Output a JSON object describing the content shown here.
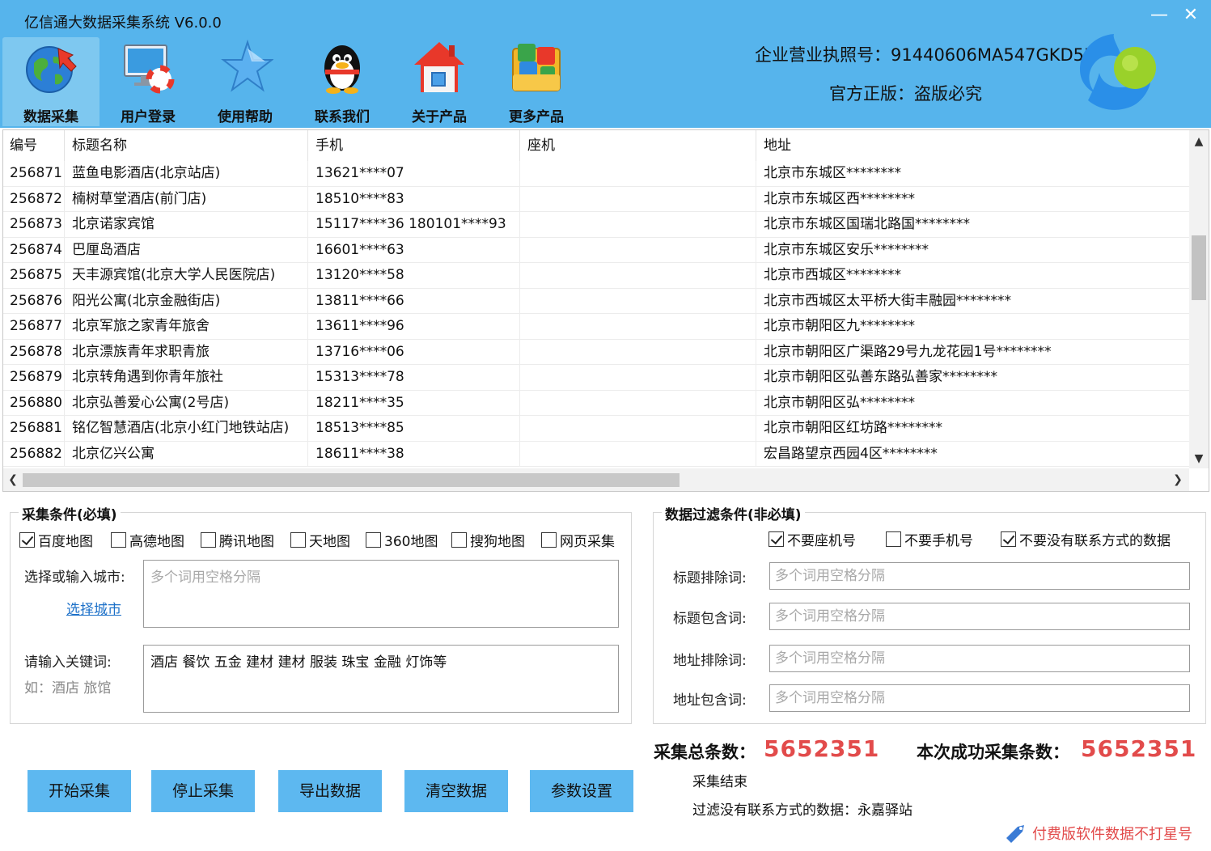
{
  "app": {
    "title": "亿信通大数据采集系统 V6.0.0",
    "minimize": "—",
    "close": "✕"
  },
  "toolbar": [
    {
      "label": "数据采集",
      "icon": "globe-icon"
    },
    {
      "label": "用户登录",
      "icon": "monitor-lifebuoy-icon"
    },
    {
      "label": "使用帮助",
      "icon": "star-icon"
    },
    {
      "label": "联系我们",
      "icon": "penguin-icon"
    },
    {
      "label": "关于产品",
      "icon": "house-icon"
    },
    {
      "label": "更多产品",
      "icon": "folder-apps-icon"
    }
  ],
  "header": {
    "license": "企业营业执照号：91440606MA547GKD5K",
    "genuine": "官方正版：盗版必究"
  },
  "table": {
    "columns": [
      "编号",
      "标题名称",
      "手机",
      "座机",
      "地址"
    ],
    "rows": [
      [
        "256871",
        "蓝鱼电影酒店(北京站店)",
        "13621****07",
        "",
        "北京市东城区********"
      ],
      [
        "256872",
        "楠树草堂酒店(前门店)",
        "18510****83",
        "",
        "北京市东城区西********"
      ],
      [
        "256873",
        "北京诺家宾馆",
        "15117****36 180101****93",
        "",
        "北京市东城区国瑞北路国********"
      ],
      [
        "256874",
        "巴厘岛酒店",
        "16601****63",
        "",
        "北京市东城区安乐********"
      ],
      [
        "256875",
        "天丰源宾馆(北京大学人民医院店)",
        "13120****58",
        "",
        "北京市西城区********"
      ],
      [
        "256876",
        "阳光公寓(北京金融街店)",
        "13811****66",
        "",
        "北京市西城区太平桥大街丰融园********"
      ],
      [
        "256877",
        "北京军旅之家青年旅舍",
        "13611****96",
        "",
        "北京市朝阳区九********"
      ],
      [
        "256878",
        "北京漂族青年求职青旅",
        "13716****06",
        "",
        "北京市朝阳区广渠路29号九龙花园1号********"
      ],
      [
        "256879",
        "北京转角遇到你青年旅社",
        "15313****78",
        "",
        "北京市朝阳区弘善东路弘善家********"
      ],
      [
        "256880",
        "北京弘善爱心公寓(2号店)",
        "18211****35",
        "",
        "北京市朝阳区弘********"
      ],
      [
        "256881",
        "铭亿智慧酒店(北京小红门地铁站店)",
        "18513****85",
        "",
        "北京市朝阳区红坊路********"
      ],
      [
        "256882",
        "北京亿兴公寓",
        "18611****38",
        "",
        "宏昌路望京西园4区********"
      ]
    ]
  },
  "collect": {
    "title": "采集条件(必填)",
    "sources": [
      {
        "label": "百度地图",
        "checked": true
      },
      {
        "label": "高德地图",
        "checked": false
      },
      {
        "label": "腾讯地图",
        "checked": false
      },
      {
        "label": "天地图",
        "checked": false
      },
      {
        "label": "360地图",
        "checked": false
      },
      {
        "label": "搜狗地图",
        "checked": false
      },
      {
        "label": "网页采集",
        "checked": false
      }
    ],
    "city_label": "选择或输入城市:",
    "city_placeholder": "多个词用空格分隔",
    "city_link": "选择城市",
    "keyword_label": "请输入关键词:",
    "keyword_hint": "如：酒店 旅馆",
    "keyword_value": "酒店 餐饮 五金 建材 建材 服装 珠宝 金融 灯饰等"
  },
  "filter": {
    "title": "数据过滤条件(非必填)",
    "options": [
      {
        "label": "不要座机号",
        "checked": true
      },
      {
        "label": "不要手机号",
        "checked": false
      },
      {
        "label": "不要没有联系方式的数据",
        "checked": true
      }
    ],
    "fields": [
      {
        "label": "标题排除词:",
        "placeholder": "多个词用空格分隔"
      },
      {
        "label": "标题包含词:",
        "placeholder": "多个词用空格分隔"
      },
      {
        "label": "地址排除词:",
        "placeholder": "多个词用空格分隔"
      },
      {
        "label": "地址包含词:",
        "placeholder": "多个词用空格分隔"
      }
    ]
  },
  "stats": {
    "total_label": "采集总条数：",
    "total_value": "5652351",
    "success_label": "本次成功采集条数：",
    "success_value": "5652351",
    "status": "采集结束",
    "filter_note": "过滤没有联系方式的数据：永嘉驿站"
  },
  "buttons": [
    "开始采集",
    "停止采集",
    "导出数据",
    "清空数据",
    "参数设置"
  ],
  "promo": "付费版软件数据不打星号",
  "colors": {
    "header_bg": "#56b4ec",
    "button_bg": "#5db8f0",
    "stat_value": "#e24b4b",
    "link": "#1c70c8"
  }
}
